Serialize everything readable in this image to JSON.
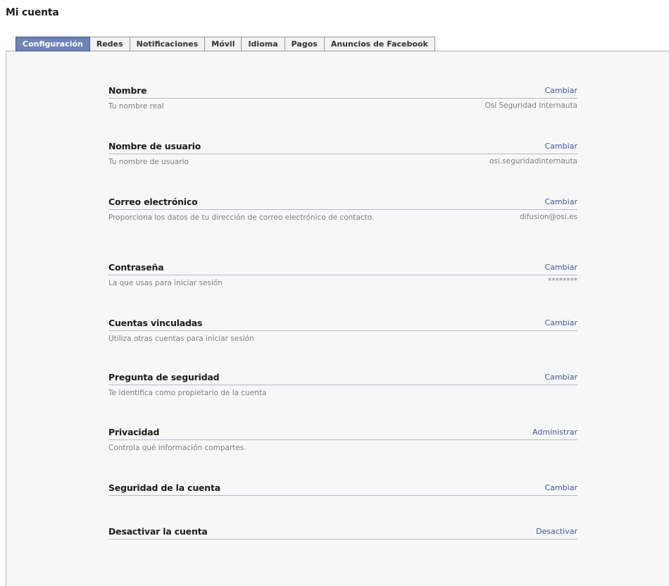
{
  "page": {
    "title": "Mi cuenta"
  },
  "tabs": [
    {
      "label": "Configuración",
      "active": true
    },
    {
      "label": "Redes",
      "active": false
    },
    {
      "label": "Notificaciones",
      "active": false
    },
    {
      "label": "Móvil",
      "active": false
    },
    {
      "label": "Idioma",
      "active": false
    },
    {
      "label": "Pagos",
      "active": false
    },
    {
      "label": "Anuncios de Facebook",
      "active": false
    }
  ],
  "settings": {
    "nombre": {
      "title": "Nombre",
      "action": "Cambiar",
      "description": "Tu nombre real",
      "value": "Osi Seguridad Internauta"
    },
    "usuario": {
      "title": "Nombre de usuario",
      "action": "Cambiar",
      "description": "Tu nombre de usuario",
      "value": "osi.seguridadinternauta"
    },
    "correo": {
      "title": "Correo electrónico",
      "action": "Cambiar",
      "description": "Proporciona los datos de tu dirección de correo electrónico de contacto.",
      "value": "difusion@osi.es"
    },
    "contrasena": {
      "title": "Contraseña",
      "action": "Cambiar",
      "description": "La que usas para iniciar sesión",
      "value": "********"
    },
    "vinculadas": {
      "title": "Cuentas vinculadas",
      "action": "Cambiar",
      "description": "Utiliza otras cuentas para iniciar sesión"
    },
    "pregunta": {
      "title": "Pregunta de seguridad",
      "action": "Cambiar",
      "description": "Te identifica como propietario de la cuenta"
    },
    "privacidad": {
      "title": "Privacidad",
      "action": "Administrar",
      "description": "Controla qué información compartes."
    },
    "seguridad": {
      "title": "Seguridad de la cuenta",
      "action": "Cambiar"
    },
    "desactivar": {
      "title": "Desactivar la cuenta",
      "action": "Desactivar"
    }
  },
  "colors": {
    "link": "#3b5998",
    "active_tab": "#6d84b4",
    "muted_text": "#808080",
    "panel_bg": "#f7f7f7"
  }
}
